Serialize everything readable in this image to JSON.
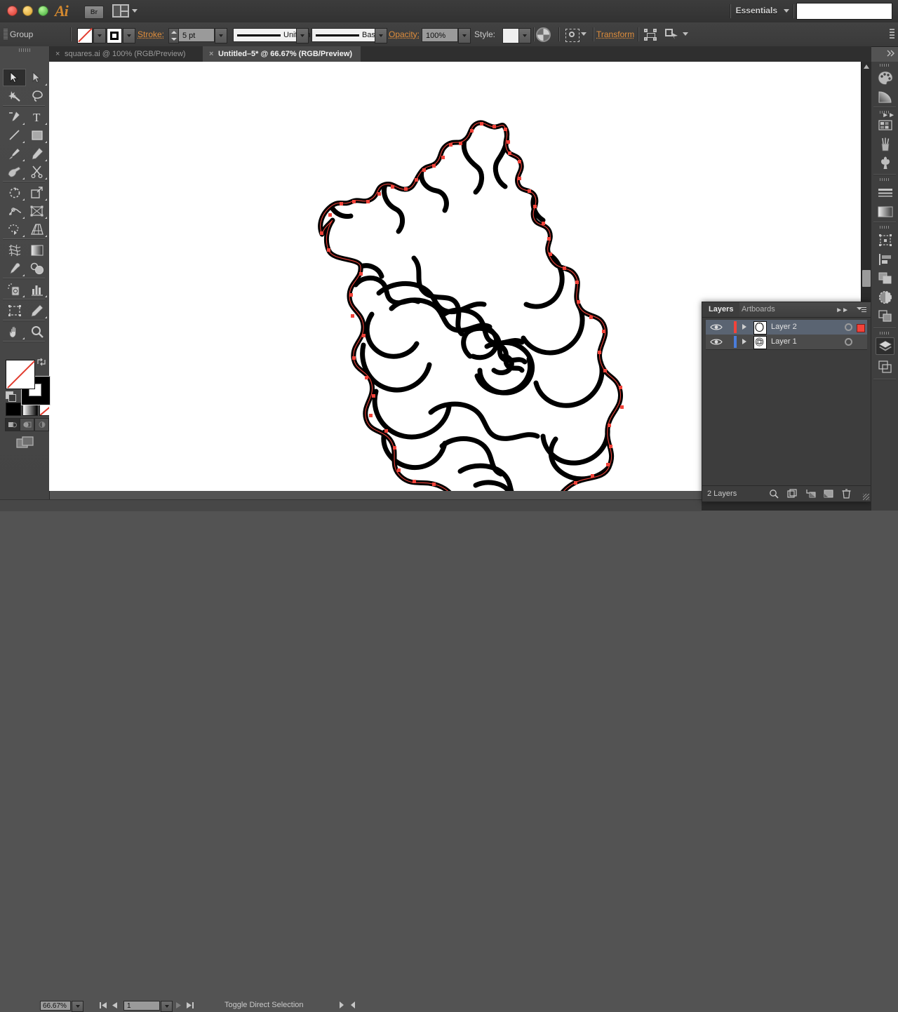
{
  "app": {
    "name": "Adobe Illustrator",
    "logo_text": "Ai",
    "bridge_label": "Br",
    "workspace": "Essentials",
    "search_value": ""
  },
  "control_bar": {
    "selection_label": "Group",
    "fill_swatch": "none",
    "stroke_swatch": "black",
    "stroke_label": "Stroke:",
    "stroke_weight": "5 pt",
    "stroke_profile": "Uniform",
    "brush_definition": "Basic",
    "opacity_label": "Opacity:",
    "opacity_value": "100%",
    "style_label": "Style:",
    "transform_label": "Transform",
    "accent_color": "#e08e3c"
  },
  "tabs": [
    {
      "label": "squares.ai @ 100% (RGB/Preview)",
      "active": false,
      "close": "×"
    },
    {
      "label": "Untitled–5* @ 66.67% (RGB/Preview)",
      "active": true,
      "close": "×"
    }
  ],
  "toolbar": {
    "tools": [
      "selection-tool",
      "direct-selection-tool",
      "magic-wand-tool",
      "lasso-tool",
      "pen-tool",
      "type-tool",
      "line-segment-tool",
      "rectangle-tool",
      "paintbrush-tool",
      "pencil-tool",
      "blob-brush-tool",
      "scissors-tool",
      "rotate-tool",
      "scale-tool",
      "width-tool",
      "free-transform-tool",
      "shape-builder-tool",
      "perspective-grid-tool",
      "mesh-tool",
      "gradient-tool",
      "eyedropper-tool",
      "blend-tool",
      "symbol-sprayer-tool",
      "column-graph-tool",
      "artboard-tool",
      "slice-tool",
      "hand-tool",
      "zoom-tool"
    ],
    "active_tool": "selection-tool",
    "fill_state": "none",
    "stroke_state": "black",
    "color_modes": [
      "color",
      "gradient",
      "none"
    ],
    "draw_modes": [
      "draw-normal",
      "draw-behind",
      "draw-inside"
    ],
    "active_draw_mode": "draw-normal"
  },
  "canvas": {
    "artwork_name": "rose-flame-outline",
    "background": "#ffffff",
    "stroke_color": "#000000",
    "anchor_color": "#f2433a",
    "selected_path": "outer-flame-contour"
  },
  "layers_panel": {
    "tabs": [
      {
        "label": "Layers",
        "active": true
      },
      {
        "label": "Artboards",
        "active": false
      }
    ],
    "rows": [
      {
        "name": "Layer 2",
        "visible": true,
        "color": "#f2433a",
        "selected": true,
        "has_selection_square": true,
        "thumbnail": "rose-outline-thumb"
      },
      {
        "name": "Layer 1",
        "visible": true,
        "color": "#4a7ddb",
        "selected": false,
        "has_selection_square": false,
        "thumbnail": "rose-detail-thumb"
      }
    ],
    "footer_count": "2 Layers",
    "footer_icons": [
      "locate-object-icon",
      "make-clipping-mask-icon",
      "create-new-sublayer-icon",
      "create-new-layer-icon",
      "delete-selection-icon"
    ]
  },
  "right_dock": {
    "groups": [
      [
        "color-panel-icon",
        "gradient-panel-icon"
      ],
      [
        "swatches-panel-icon",
        "brushes-panel-icon",
        "symbols-panel-icon"
      ],
      [
        "stroke-panel-icon",
        "gradient2-panel-icon"
      ],
      [
        "transform-panel-icon",
        "align-panel-icon",
        "pathfinder-panel-icon",
        "transparency-panel-icon",
        "appearance-panel-icon"
      ],
      [
        "layers-panel-icon",
        "artboards-panel-icon"
      ]
    ],
    "active": "layers-panel-icon"
  },
  "status_bar": {
    "zoom_level": "66.67%",
    "page_number": "1",
    "status_text": "Toggle Direct Selection"
  }
}
